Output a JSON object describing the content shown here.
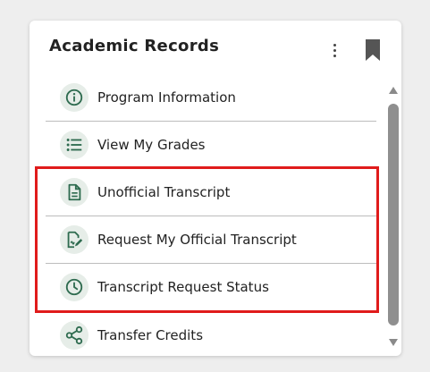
{
  "card": {
    "title": "Academic Records",
    "menu_icon": "kebab-menu-icon",
    "bookmark_icon": "bookmark-icon"
  },
  "items": [
    {
      "label": "Program Information",
      "icon": "info-icon"
    },
    {
      "label": "View My Grades",
      "icon": "list-icon"
    },
    {
      "label": "Unofficial Transcript",
      "icon": "document-icon"
    },
    {
      "label": "Request My Official Transcript",
      "icon": "edit-document-icon"
    },
    {
      "label": "Transcript Request Status",
      "icon": "clock-icon"
    },
    {
      "label": "Transfer Credits",
      "icon": "share-icon"
    }
  ],
  "colors": {
    "icon_green": "#2e6b4f",
    "icon_bg": "#e6ede8",
    "highlight_red": "#e01b1b"
  }
}
